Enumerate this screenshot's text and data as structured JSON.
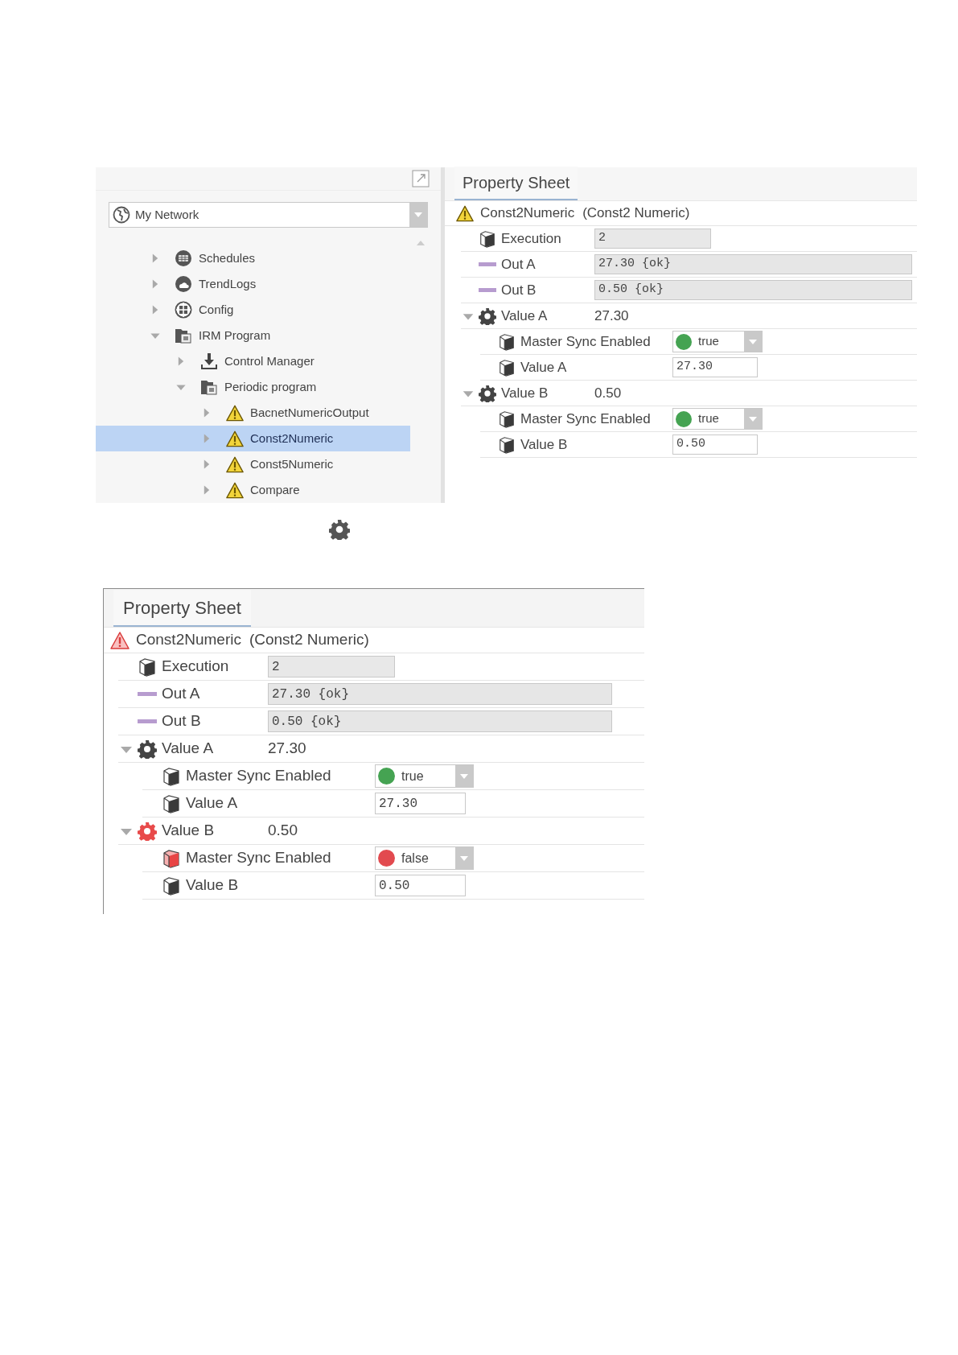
{
  "navigator": {
    "network": "My Network",
    "tree": [
      {
        "label": "Schedules",
        "kind": "schedules",
        "expanded": false,
        "selected": false
      },
      {
        "label": "TrendLogs",
        "kind": "trend",
        "expanded": false,
        "selected": false
      },
      {
        "label": "Config",
        "kind": "config",
        "expanded": false,
        "selected": false
      },
      {
        "label": "IRM Program",
        "kind": "program",
        "expanded": true,
        "selected": false,
        "children": [
          {
            "label": "Control Manager",
            "kind": "download",
            "expanded": false,
            "selected": false
          },
          {
            "label": "Periodic program",
            "kind": "program",
            "expanded": true,
            "selected": false,
            "children": [
              {
                "label": "BacnetNumericOutput",
                "kind": "warning",
                "expanded": false,
                "selected": false
              },
              {
                "label": "Const2Numeric",
                "kind": "warning",
                "expanded": false,
                "selected": true
              },
              {
                "label": "Const5Numeric",
                "kind": "warning",
                "expanded": false,
                "selected": false
              },
              {
                "label": "Compare",
                "kind": "warning",
                "expanded": false,
                "selected": false
              }
            ]
          }
        ]
      }
    ]
  },
  "property_sheets": [
    {
      "tab": "Property Sheet",
      "name": "Const2Numeric",
      "type": "(Const2 Numeric)",
      "alarm": false,
      "rows": [
        {
          "kind": "slot",
          "label": "Execution",
          "value": "2",
          "fault": false
        },
        {
          "kind": "output",
          "label": "Out A",
          "value": "27.30 {ok}"
        },
        {
          "kind": "output",
          "label": "Out B",
          "value": "0.50 {ok}"
        },
        {
          "kind": "folder",
          "label": "Value A",
          "value": "27.30",
          "expanded": true,
          "fault": false,
          "children": [
            {
              "kind": "boolean",
              "label": "Master Sync Enabled",
              "value": "true",
              "on": true,
              "fault": false
            },
            {
              "kind": "numeric",
              "label": "Value A",
              "value": "27.30",
              "fault": false
            }
          ]
        },
        {
          "kind": "folder",
          "label": "Value B",
          "value": "0.50",
          "expanded": true,
          "fault": false,
          "children": [
            {
              "kind": "boolean",
              "label": "Master Sync Enabled",
              "value": "true",
              "on": true,
              "fault": false
            },
            {
              "kind": "numeric",
              "label": "Value B",
              "value": "0.50",
              "fault": false
            }
          ]
        }
      ]
    },
    {
      "tab": "Property Sheet",
      "name": "Const2Numeric",
      "type": "(Const2 Numeric)",
      "alarm": true,
      "rows": [
        {
          "kind": "slot",
          "label": "Execution",
          "value": "2",
          "fault": false
        },
        {
          "kind": "output",
          "label": "Out A",
          "value": "27.30 {ok}"
        },
        {
          "kind": "output",
          "label": "Out B",
          "value": "0.50 {ok}"
        },
        {
          "kind": "folder",
          "label": "Value A",
          "value": "27.30",
          "expanded": true,
          "fault": false,
          "children": [
            {
              "kind": "boolean",
              "label": "Master Sync Enabled",
              "value": "true",
              "on": true,
              "fault": false
            },
            {
              "kind": "numeric",
              "label": "Value A",
              "value": "27.30",
              "fault": false
            }
          ]
        },
        {
          "kind": "folder",
          "label": "Value B",
          "value": "0.50",
          "expanded": true,
          "fault": true,
          "children": [
            {
              "kind": "boolean",
              "label": "Master Sync Enabled",
              "value": "false",
              "on": false,
              "fault": true
            },
            {
              "kind": "numeric",
              "label": "Value B",
              "value": "0.50",
              "fault": false
            }
          ]
        }
      ]
    }
  ]
}
